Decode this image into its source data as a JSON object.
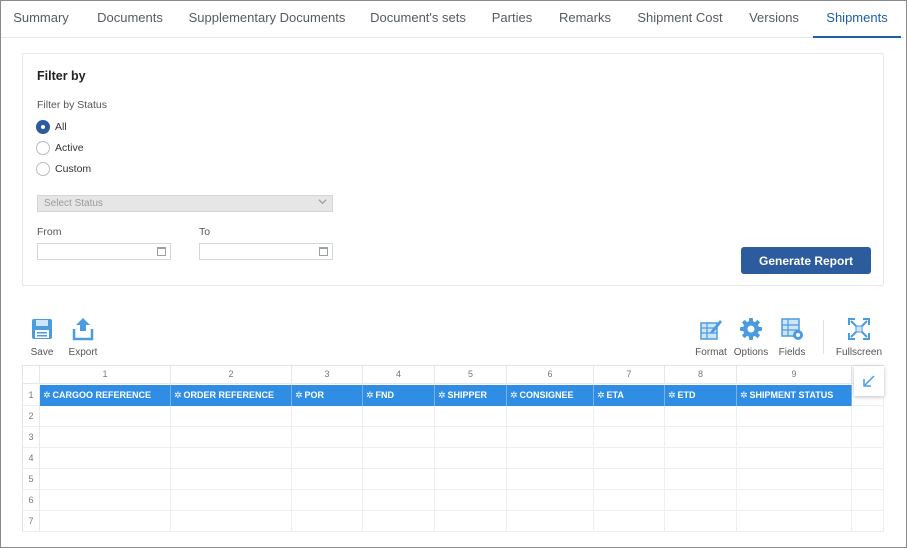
{
  "tabs": [
    "Summary",
    "Documents",
    "Supplementary Documents",
    "Document's sets",
    "Parties",
    "Remarks",
    "Shipment Cost",
    "Versions",
    "Shipments"
  ],
  "active_tab": "Shipments",
  "filter": {
    "title": "Filter by",
    "status_label": "Filter by Status",
    "options": [
      "All",
      "Active",
      "Custom"
    ],
    "selected": "All",
    "select_placeholder": "Select Status",
    "from_label": "From",
    "to_label": "To",
    "from_value": "",
    "to_value": "",
    "generate_label": "Generate Report"
  },
  "toolbar": {
    "save": "Save",
    "export": "Export",
    "format": "Format",
    "options": "Options",
    "fields": "Fields",
    "fullscreen": "Fullscreen"
  },
  "grid": {
    "column_numbers": [
      "1",
      "2",
      "3",
      "4",
      "5",
      "6",
      "7",
      "8",
      "9"
    ],
    "row_numbers": [
      "1",
      "2",
      "3",
      "4",
      "5",
      "6",
      "7"
    ],
    "headers": [
      "CARGOO REFERENCE",
      "ORDER REFERENCE",
      "POR",
      "FND",
      "SHIPPER",
      "CONSIGNEE",
      "ETA",
      "ETD",
      "SHIPMENT STATUS"
    ]
  },
  "colors": {
    "accent": "#2c5b9e",
    "header_blue": "#2f8ee3",
    "icon_blue": "#4a9be0"
  }
}
